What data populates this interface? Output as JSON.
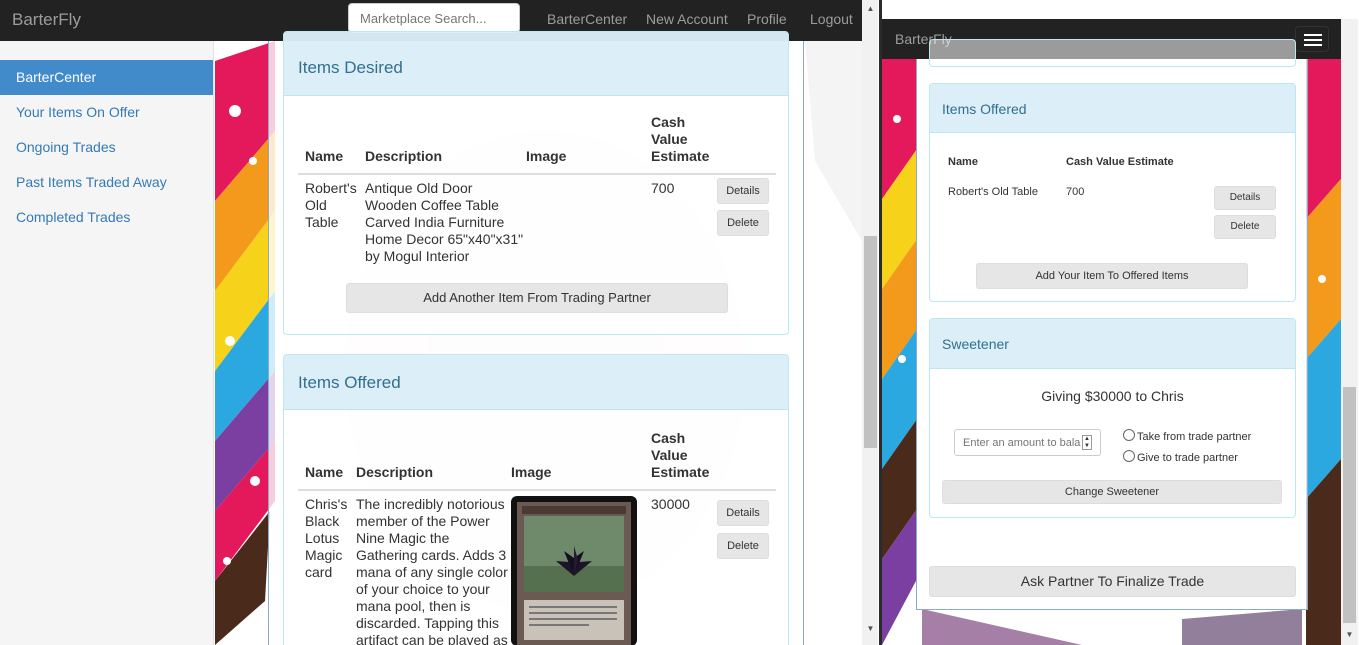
{
  "left_window": {
    "navbar": {
      "brand": "BarterFly",
      "search_placeholder": "Marketplace Search...",
      "links": [
        "BarterCenter",
        "New Account",
        "Profile",
        "Logout"
      ]
    },
    "sidebar": {
      "items": [
        {
          "label": "BarterCenter",
          "active": true
        },
        {
          "label": "Your Items On Offer"
        },
        {
          "label": "Ongoing Trades"
        },
        {
          "label": "Past Items Traded Away"
        },
        {
          "label": "Completed Trades"
        }
      ]
    },
    "items_desired": {
      "title": "Items Desired",
      "columns": {
        "name": "Name",
        "description": "Description",
        "image": "Image",
        "cash": [
          "Cash",
          "Value",
          "Estimate"
        ]
      },
      "row": {
        "name": [
          "Robert's",
          "Old",
          "Table"
        ],
        "description": [
          "Antique Old Door",
          "Wooden Coffee Table",
          "Carved India Furniture",
          "Home Decor 65\"x40\"x31\"",
          "by Mogul Interior"
        ],
        "value": "700",
        "details_label": "Details",
        "delete_label": "Delete"
      },
      "add_button": "Add Another Item From Trading Partner"
    },
    "items_offered": {
      "title": "Items Offered",
      "columns": {
        "name": "Name",
        "description": "Description",
        "image": "Image",
        "cash": [
          "Cash",
          "Value",
          "Estimate"
        ]
      },
      "row": {
        "name": [
          "Chris's",
          "Black",
          "Lotus",
          "Magic",
          "card"
        ],
        "description": [
          "The incredibly notorious",
          "member of the Power",
          "Nine Magic the",
          "Gathering cards. Adds 3",
          "mana of any single color",
          "of your choice to your",
          "mana pool, then is",
          "discarded. Tapping this",
          "artifact can be played as"
        ],
        "value": "30000",
        "details_label": "Details",
        "delete_label": "Delete"
      }
    }
  },
  "right_window": {
    "navbar": {
      "brand": "BarterFly"
    },
    "items_offered": {
      "title": "Items Offered",
      "columns": {
        "name": "Name",
        "cash": "Cash Value Estimate"
      },
      "row": {
        "name": "Robert's Old Table",
        "value": "700",
        "details_label": "Details",
        "delete_label": "Delete"
      },
      "add_button": "Add Your Item To Offered Items"
    },
    "sweetener": {
      "title": "Sweetener",
      "giving_text": "Giving $30000 to Chris",
      "amount_placeholder": "Enter an amount to balance",
      "options": [
        "Take from trade partner",
        "Give to trade partner"
      ],
      "change_button": "Change Sweetener"
    },
    "finalize_button": "Ask Partner To Finalize Trade"
  },
  "colors": {
    "navbar": "#222222",
    "brand_text": "#9d9d9d",
    "active_sidebar": "#428bca",
    "link": "#337ab7",
    "panel_heading": "#d9edf7",
    "panel_heading_text": "#31708f"
  }
}
